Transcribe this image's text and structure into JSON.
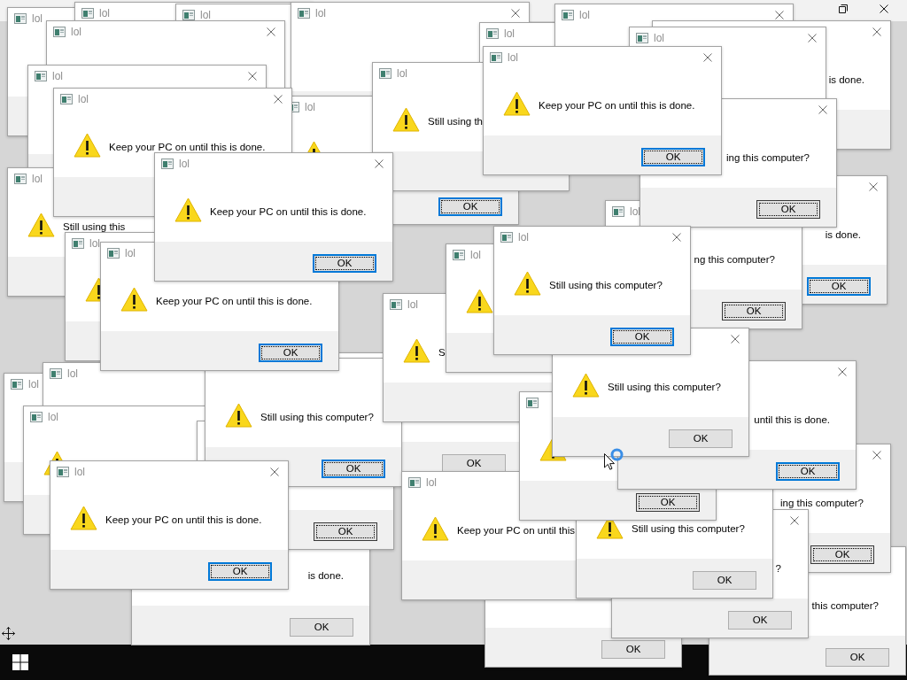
{
  "dialogs": [
    {
      "title": "lol"
    },
    {
      "title": "lol"
    },
    {
      "title": "lol"
    },
    {
      "title": "lol"
    },
    {
      "title": "lol"
    },
    {
      "title": "lol"
    },
    {
      "title": "lol"
    },
    {
      "title": "lol"
    },
    {
      "message": "is done."
    },
    {
      "title": "lol"
    },
    {
      "title": "lol",
      "message": "Still using th"
    },
    {
      "title": "lol",
      "message": "Keep your PC on until this is done.",
      "button": "OK",
      "focused": true,
      "highlighted": true
    },
    {
      "title": "lol",
      "message": "Keep your PC on until this is done."
    },
    {
      "title": "lol",
      "button": "OK",
      "focused": true,
      "highlighted": true
    },
    {
      "message": "ing this computer?",
      "button": "OK",
      "focused": true,
      "highlighted": false
    },
    {
      "title": "lol",
      "message": "Still using this"
    },
    {
      "title": "lol",
      "message": "Keep your PC on until this is done.",
      "button": "OK",
      "focused": true,
      "highlighted": true
    },
    {
      "title": "lol",
      "message": "ng this computer?",
      "button": "OK",
      "focused": true,
      "highlighted": false
    },
    {
      "message": "is done.",
      "button": "OK",
      "focused": true,
      "highlighted": true
    },
    {
      "title": "lol"
    },
    {
      "title": "lol",
      "message": "Keep your PC on until this is done.",
      "button": "OK",
      "focused": true,
      "highlighted": true
    },
    {
      "title": "lol"
    },
    {
      "title": "lol",
      "message": "Still using this computer?",
      "button": "OK",
      "focused": true,
      "highlighted": true
    },
    {
      "title": "lol",
      "message": "S"
    },
    {
      "message": "Still using this computer?",
      "button": "OK",
      "focused": false,
      "highlighted": false
    },
    {
      "title": "lol"
    },
    {
      "title": "lol"
    },
    {
      "message": "Still using this computer?",
      "button": "OK",
      "focused": true,
      "highlighted": true
    },
    {
      "button": "OK",
      "focused": false,
      "highlighted": false
    },
    {
      "message": "until this is done.",
      "button": "OK",
      "focused": true,
      "highlighted": true
    },
    {
      "title": "lol"
    },
    {
      "button": "OK",
      "focused": true,
      "highlighted": false
    },
    {
      "button": "OK",
      "focused": true,
      "highlighted": false
    },
    {
      "title": "lol",
      "message": "Keep your PC on until this is done.",
      "button": "OK",
      "focused": true,
      "highlighted": true
    },
    {
      "title": "lol",
      "message": "Keep your PC on until this"
    },
    {
      "message": "Still using this computer?",
      "button": "OK",
      "focused": false,
      "highlighted": false
    },
    {
      "message": "ing this computer?",
      "button": "OK",
      "focused": true,
      "highlighted": false
    },
    {
      "message": "is done.",
      "button": "OK",
      "focused": false,
      "highlighted": false
    },
    {
      "message": "?",
      "button": "OK",
      "focused": false,
      "highlighted": false
    },
    {
      "button": "OK",
      "focused": false,
      "highlighted": false
    },
    {
      "message": "this computer?",
      "button": "OK",
      "focused": false,
      "highlighted": false
    }
  ]
}
